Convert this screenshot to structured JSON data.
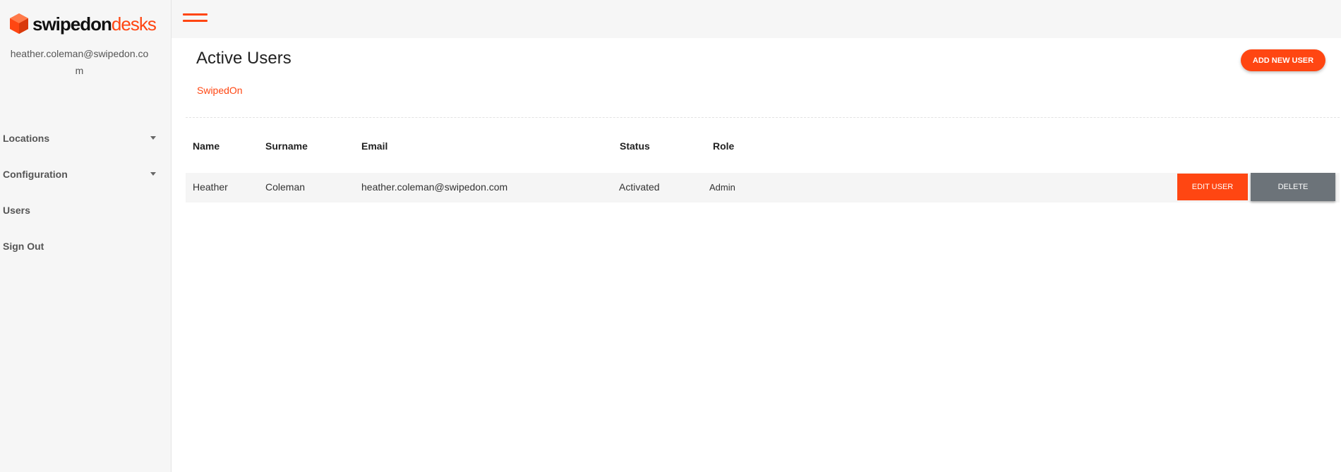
{
  "brand": {
    "logo_part1": "swipedon",
    "logo_part2": "desks",
    "accent_color": "#ff4612"
  },
  "sidebar": {
    "user_email": "heather.coleman@swipedon.com",
    "items": [
      {
        "label": "Locations",
        "has_dropdown": true
      },
      {
        "label": "Configuration",
        "has_dropdown": true
      },
      {
        "label": "Users",
        "has_dropdown": false
      },
      {
        "label": "Sign Out",
        "has_dropdown": false
      }
    ]
  },
  "topbar": {
    "menu_icon": "hamburger-icon"
  },
  "main": {
    "title": "Active Users",
    "organization": "SwipedOn",
    "add_button_label": "ADD NEW USER"
  },
  "table": {
    "columns": [
      "Name",
      "Surname",
      "Email",
      "Status",
      "Role"
    ],
    "rows": [
      {
        "name": "Heather",
        "surname": "Coleman",
        "email": "heather.coleman@swipedon.com",
        "status": "Activated",
        "role": "Admin",
        "edit_label": "EDIT USER",
        "delete_label": "DELETE"
      }
    ]
  }
}
